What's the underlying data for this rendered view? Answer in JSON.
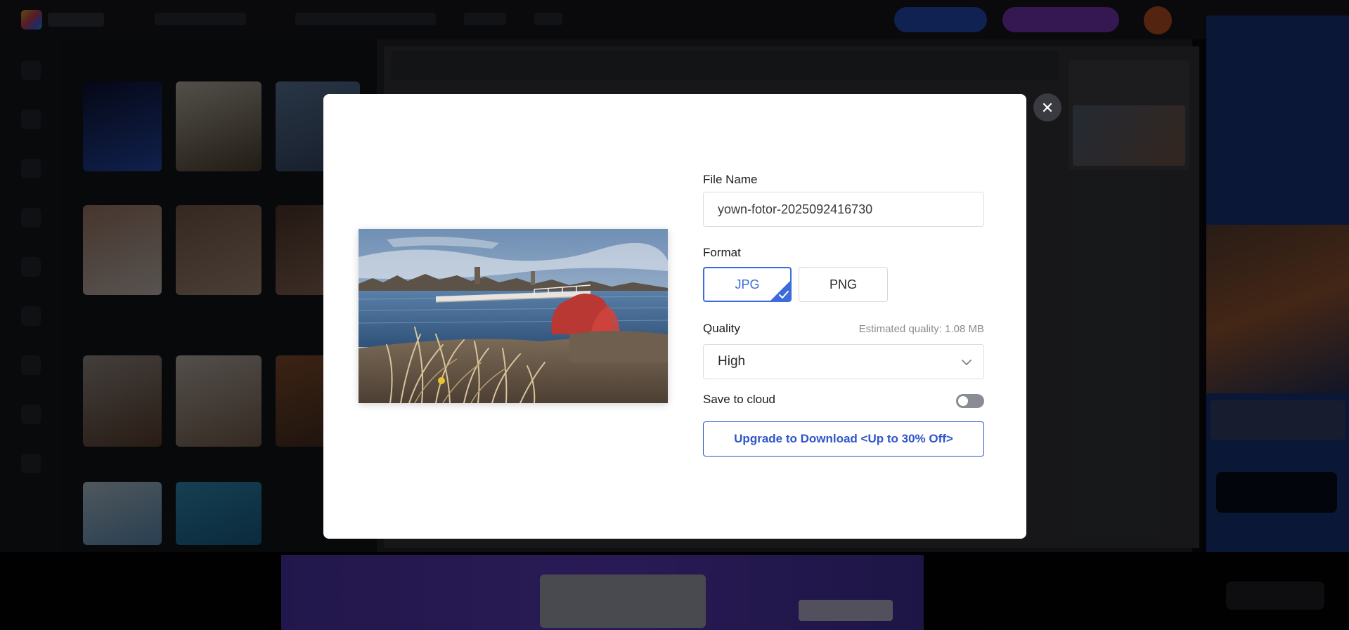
{
  "dialog": {
    "file_name_label": "File Name",
    "file_name_value": "yown-fotor-2025092416730",
    "format_label": "Format",
    "formats": [
      {
        "label": "JPG",
        "selected": true
      },
      {
        "label": "PNG",
        "selected": false
      }
    ],
    "quality_label": "Quality",
    "estimated_quality": "Estimated quality: 1.08 MB",
    "quality_selected": "High",
    "save_to_cloud_label": "Save to cloud",
    "save_to_cloud_enabled": false,
    "upgrade_button_label": "Upgrade to Download <Up to 30% Off>",
    "close_icon": "close-icon",
    "preview_image": "lakeside-landscape-photo"
  },
  "colors": {
    "accent": "#3b6cd9",
    "upgrade_border": "#2f55c9",
    "toggle_off": "#8a8c93"
  }
}
